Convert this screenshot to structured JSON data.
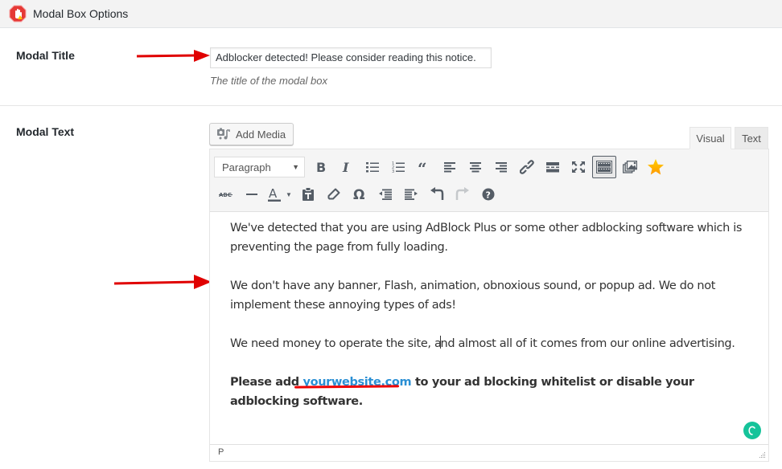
{
  "header": {
    "title": "Modal Box Options",
    "icon": "stop-hand-icon"
  },
  "modal_title": {
    "label": "Modal Title",
    "value": "Adblocker detected! Please consider reading this notice.",
    "description": "The title of the modal box"
  },
  "modal_text": {
    "label": "Modal Text",
    "add_media_label": "Add Media",
    "tabs": [
      {
        "label": "Visual",
        "active": true
      },
      {
        "label": "Text",
        "active": false
      }
    ],
    "toolbar": {
      "format_select": "Paragraph",
      "row1": [
        "bold",
        "italic",
        "bulleted-list",
        "numbered-list",
        "blockquote",
        "align-left",
        "align-center",
        "align-right",
        "insert-link",
        "read-more",
        "fullscreen",
        "toolbar-toggle",
        "gallery",
        "star"
      ],
      "row2": [
        "strikethrough",
        "horizontal-line",
        "text-color",
        "paste-as-text",
        "clear-formatting",
        "special-character",
        "decrease-indent",
        "increase-indent",
        "undo",
        "redo",
        "help"
      ]
    },
    "paragraphs": {
      "p1": "We've detected that you are using AdBlock Plus or some other adblocking software which is preventing the page from fully loading.",
      "p2": "We don't have any banner, Flash, animation, obnoxious sound, or popup ad. We do not implement these annoying types of ads!",
      "p3_before_cursor": "We need money to operate the site, a",
      "p3_after_cursor": "nd almost all of it comes from our online advertising.",
      "p4_before_link": "Please add ",
      "p4_link": "yourwebsite.com",
      "p4_after_link": " to your ad blocking whitelist or disable your adblocking software."
    },
    "status_path": "P"
  },
  "colors": {
    "annotation_red": "#e00000",
    "link_blue": "#2a8fd4",
    "grammarly_green": "#15c39a",
    "star_gold": "#ffb900"
  }
}
